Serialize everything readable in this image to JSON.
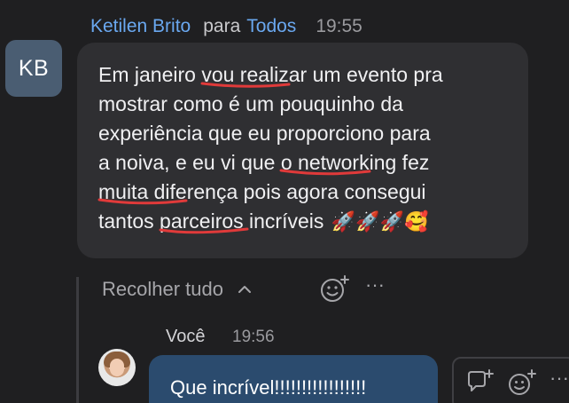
{
  "message": {
    "sender": "Ketilen Brito",
    "to_word": "para",
    "recipient": "Todos",
    "time": "19:55",
    "avatar_initials": "KB",
    "lines": [
      [
        "Em janeiro ",
        "vou realizar um evento",
        " pra"
      ],
      "mostrar como é um pouquinho da",
      "experiência que eu proporciono para",
      [
        "a noiva, e eu vi que ",
        "o networking fez",
        ""
      ],
      [
        "",
        "muita diferença",
        " pois agora consegui"
      ],
      [
        "tantos ",
        "parceiros incríveis",
        " "
      ]
    ],
    "emojis": "🚀🚀🚀🥰"
  },
  "thread": {
    "collapse_label": "Recolher tudo",
    "collapse_icon": "chevron-up-icon",
    "react_icon": "add-reaction-icon",
    "more_icon": "more-options-icon",
    "more_glyph": "···"
  },
  "reply": {
    "sender": "Você",
    "time": "19:56",
    "text": "Que incrível!!!!!!!!!!!!!!!!!"
  },
  "actions": {
    "reply_icon": "reply-in-thread-icon",
    "react_icon": "add-reaction-icon",
    "more_glyph": "···"
  },
  "colors": {
    "background": "#1f1f21",
    "bubble": "#2f2f32",
    "reply_bubble": "#2b4b6e",
    "name_link": "#6aa8f0",
    "underline": "#e03a3a"
  }
}
